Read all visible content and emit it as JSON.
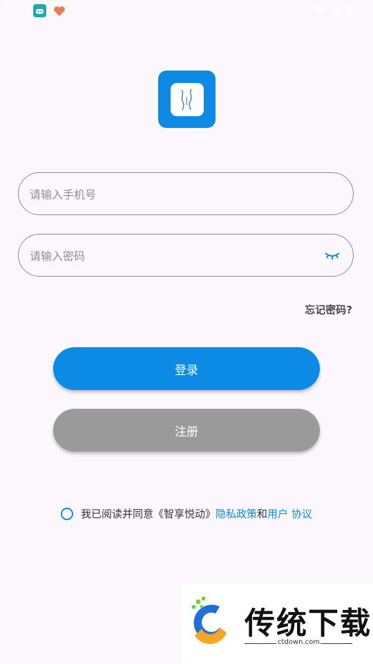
{
  "status_bar": {
    "time": "9:07"
  },
  "login": {
    "phone_placeholder": "请输入手机号",
    "password_placeholder": "请输入密码",
    "forgot_password": "忘记密码?",
    "login_button": "登录",
    "register_button": "注册"
  },
  "agreement": {
    "prefix": "我已阅读并同意《智享悦动》",
    "privacy_link": "隐私政策",
    "conjunction": "和",
    "user_agreement_link": "用户 协议"
  },
  "watermark": {
    "title": "传统下载",
    "url": "ctdown.com"
  },
  "colors": {
    "primary": "#0b8be6",
    "disabled": "#9a9a9a",
    "background": "#fcf7fd"
  },
  "icons": {
    "eye": "eye-closed-icon",
    "logo": "app-logo-icon"
  }
}
